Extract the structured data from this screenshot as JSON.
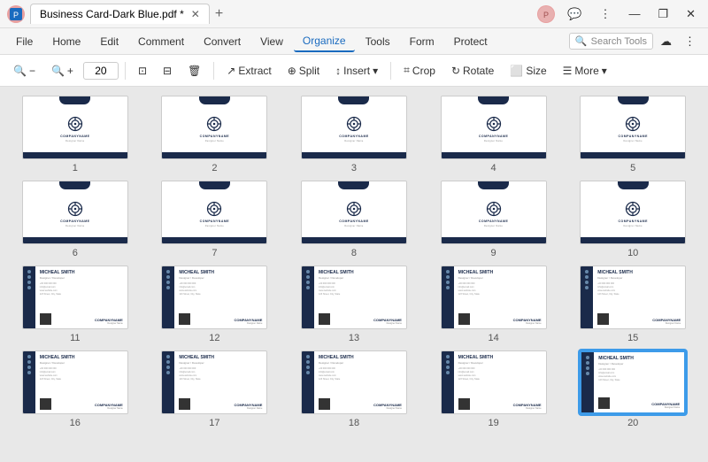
{
  "titleBar": {
    "tab": "Business Card-Dark Blue.pdf *",
    "addTab": "+",
    "avatar": "👤",
    "winBtns": [
      "—",
      "❐",
      "✕"
    ]
  },
  "menuBar": {
    "items": [
      "File",
      "Home",
      "Edit",
      "Comment",
      "Convert",
      "View",
      "Organize",
      "Tools",
      "Form",
      "Protect"
    ],
    "activeItem": "Organize",
    "searchPlaceholder": "Search Tools",
    "cloudIcon": "☁",
    "moreIcon": "⋮"
  },
  "toolbar": {
    "zoomOut": "🔍−",
    "zoomIn": "🔍+",
    "zoomValue": "20",
    "fitPage": "⊡",
    "fitWidth": "⊟",
    "delete": "🗑",
    "extract": "Extract",
    "split": "Split",
    "insert": "Insert",
    "crop": "Crop",
    "rotate": "Rotate",
    "size": "Size",
    "more": "More"
  },
  "pages": [
    {
      "num": 1,
      "type": "a"
    },
    {
      "num": 2,
      "type": "a"
    },
    {
      "num": 3,
      "type": "a"
    },
    {
      "num": 4,
      "type": "a"
    },
    {
      "num": 5,
      "type": "a"
    },
    {
      "num": 6,
      "type": "a"
    },
    {
      "num": 7,
      "type": "a"
    },
    {
      "num": 8,
      "type": "a"
    },
    {
      "num": 9,
      "type": "a"
    },
    {
      "num": 10,
      "type": "a"
    },
    {
      "num": 11,
      "type": "b"
    },
    {
      "num": 12,
      "type": "b"
    },
    {
      "num": 13,
      "type": "b"
    },
    {
      "num": 14,
      "type": "b"
    },
    {
      "num": 15,
      "type": "b"
    },
    {
      "num": 16,
      "type": "b"
    },
    {
      "num": 17,
      "type": "b"
    },
    {
      "num": 18,
      "type": "b"
    },
    {
      "num": 19,
      "type": "b"
    },
    {
      "num": 20,
      "type": "b",
      "selected": true
    }
  ]
}
